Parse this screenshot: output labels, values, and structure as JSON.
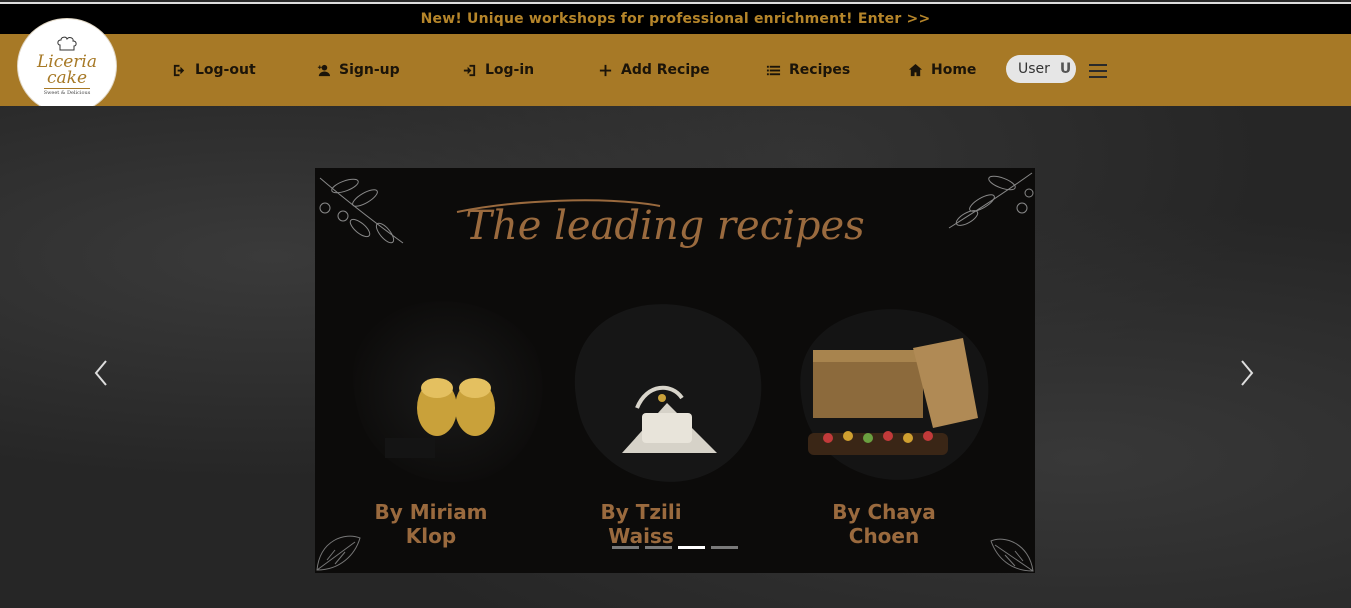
{
  "announcement": {
    "text": "New! Unique workshops for professional enrichment! Enter >>"
  },
  "logo": {
    "name_line1": "Liceria",
    "name_line2": "cake",
    "tagline": "Sweet & Delicious"
  },
  "nav": {
    "items": [
      {
        "label": "Log-out",
        "icon": "logout-icon"
      },
      {
        "label": "Sign-up",
        "icon": "person-add-icon"
      },
      {
        "label": "Log-in",
        "icon": "login-icon"
      },
      {
        "label": "Add Recipe",
        "icon": "plus-icon"
      },
      {
        "label": "Recipes",
        "icon": "list-icon"
      },
      {
        "label": "Home",
        "icon": "home-icon"
      }
    ],
    "user_label": "User",
    "user_initial": "U"
  },
  "carousel": {
    "title": "The leading recipes",
    "recipes": [
      {
        "caption": "By Miriam Klop"
      },
      {
        "caption": "By Tzili Waiss"
      },
      {
        "caption": "By Chaya Choen"
      }
    ],
    "indicator_count": 4,
    "active_index": 2
  },
  "colors": {
    "brand_gold": "#a77926",
    "caption_brown": "#9a6a3e",
    "announce_text": "#b5852a"
  }
}
